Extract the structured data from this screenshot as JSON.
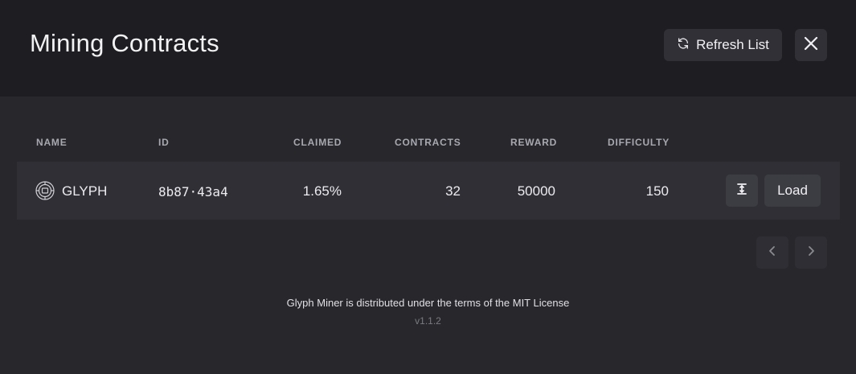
{
  "header": {
    "title": "Mining Contracts",
    "refresh_label": "Refresh List",
    "refresh_icon": "refresh-icon",
    "close_icon": "close-icon"
  },
  "table": {
    "columns": {
      "name": "NAME",
      "id": "ID",
      "claimed": "CLAIMED",
      "contracts": "CONTRACTS",
      "reward": "REWARD",
      "difficulty": "DIFFICULTY"
    },
    "rows": [
      {
        "token_icon": "glyph-token-icon",
        "name": "GLYPH",
        "id": "8b87·43a4",
        "claimed": "1.65%",
        "contracts": "32",
        "reward": "50000",
        "difficulty": "150",
        "expand_icon": "expand-vertical-icon",
        "load_label": "Load"
      }
    ]
  },
  "pagination": {
    "prev_icon": "chevron-left-icon",
    "next_icon": "chevron-right-icon"
  },
  "footer": {
    "license_text": "Glyph Miner is distributed under the terms of the MIT License",
    "version": "v1.1.2"
  },
  "colors": {
    "header_bg": "#1e1e22",
    "page_bg": "#27272c",
    "row_bg": "#2f2f35",
    "button_bg": "#303036"
  }
}
